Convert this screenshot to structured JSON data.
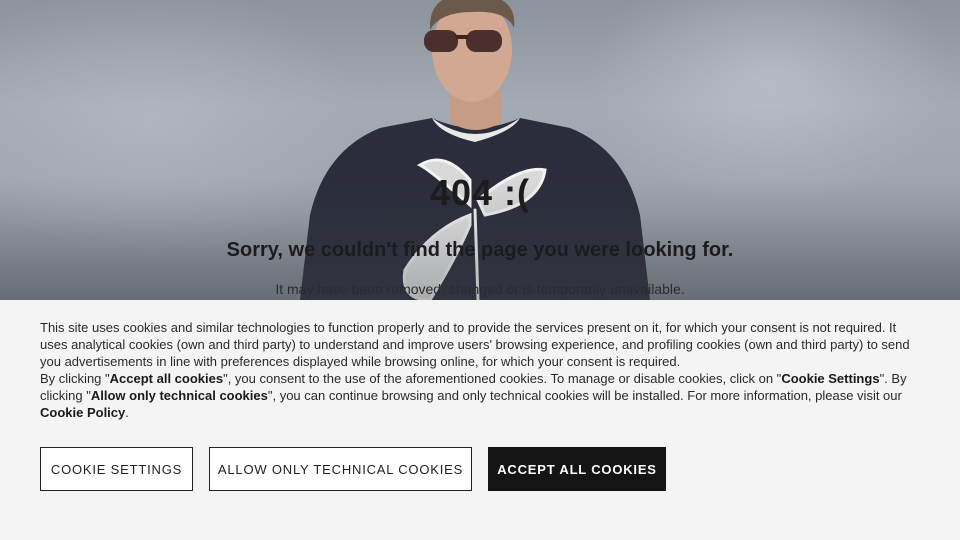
{
  "error": {
    "code": "404 :(",
    "title": "Sorry, we couldn't find the page you were looking for.",
    "subtitle": "It may have been removed, changed or is temporarily unavailable."
  },
  "cookie_banner": {
    "paragraph1": "This site uses cookies and similar technologies to function properly and to provide the services present on it, for which your consent is not required. It uses analytical cookies (own and third party) to understand and improve users' browsing experience, and profiling cookies (own and third party) to send you advertisements in line with preferences displayed while browsing online, for which your consent is required.",
    "p2_part1": "By clicking \"",
    "p2_accept_bold": "Accept all cookies",
    "p2_part2": "\", you consent to the use of the aforementioned cookies. To manage or disable cookies, click on \"",
    "p2_settings_bold": "Cookie Settings",
    "p2_part3": "\". By clicking \"",
    "p2_technical_bold": "Allow only technical cookies",
    "p2_part4": "\", you can continue browsing and only technical cookies will be installed. For more information, please visit our ",
    "p2_policy_link": "Cookie Policy",
    "p2_part5": ".",
    "buttons": {
      "settings": "Cookie settings",
      "technical": "Allow only technical cookies",
      "accept": "Accept all cookies"
    }
  },
  "colors": {
    "banner_bg": "#f4f4f4",
    "primary_button_bg": "#141414",
    "text": "#1c1c1e"
  },
  "hero_image": "model-in-sunglasses-and-flower-print-sweater"
}
